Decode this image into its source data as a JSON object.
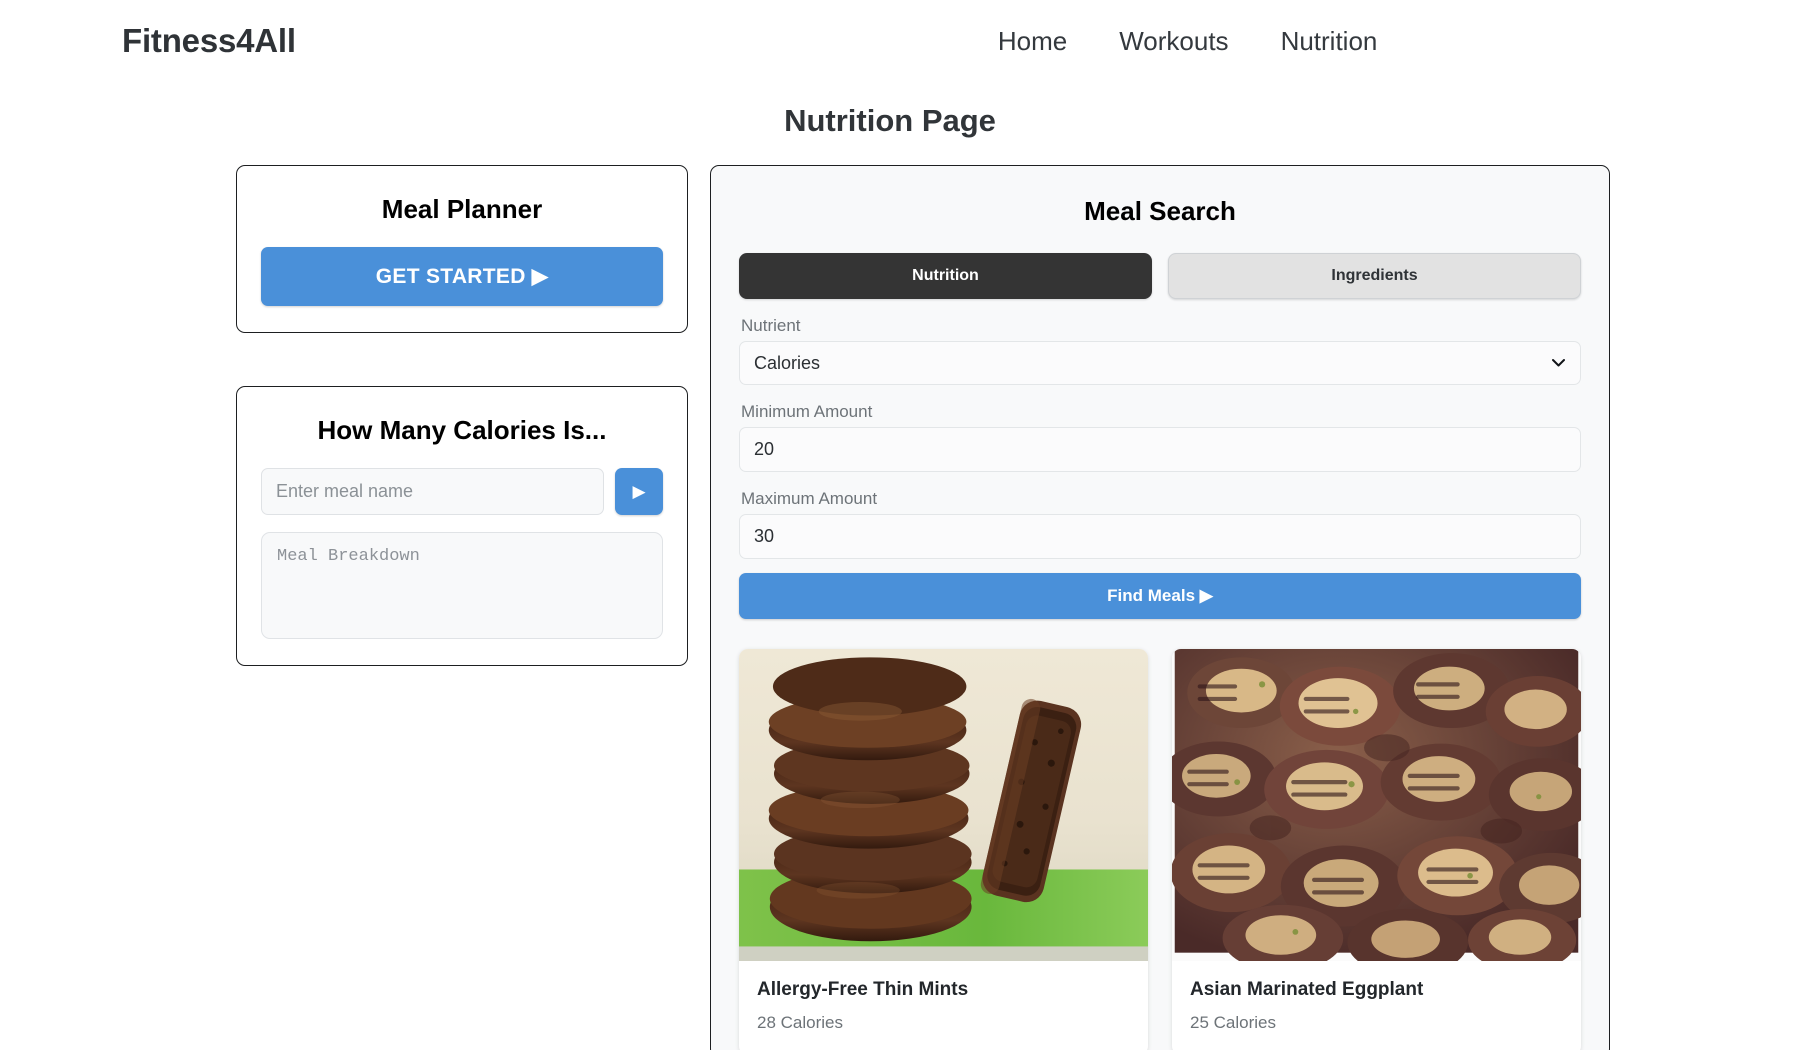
{
  "header": {
    "brand": "Fitness4All",
    "nav": [
      {
        "label": "Home"
      },
      {
        "label": "Workouts"
      },
      {
        "label": "Nutrition"
      }
    ]
  },
  "page": {
    "title": "Nutrition Page"
  },
  "meal_planner": {
    "title": "Meal Planner",
    "get_started_label": "GET STARTED ▶"
  },
  "calorie_lookup": {
    "title": "How Many Calories Is...",
    "input_value": "",
    "input_placeholder": "Enter meal name",
    "submit_icon": "▶",
    "breakdown_value": "",
    "breakdown_placeholder": "Meal Breakdown"
  },
  "meal_search": {
    "title": "Meal Search",
    "tabs": [
      {
        "label": "Nutrition",
        "active": true
      },
      {
        "label": "Ingredients",
        "active": false
      }
    ],
    "fields": {
      "nutrient_label": "Nutrient",
      "nutrient_value": "Calories",
      "nutrient_options": [
        "Calories"
      ],
      "min_label": "Minimum Amount",
      "min_value": "20",
      "max_label": "Maximum Amount",
      "max_value": "30"
    },
    "find_button_label": "Find Meals ▶",
    "results": [
      {
        "name": "Allergy-Free Thin Mints",
        "calories": "28 Calories",
        "image": "chocolate-cookie-stack-photo"
      },
      {
        "name": "Asian Marinated Eggplant",
        "calories": "25 Calories",
        "image": "grilled-eggplant-slices-photo"
      }
    ]
  },
  "colors": {
    "accent_blue": "#4a90d9",
    "tab_active": "#343434",
    "tab_inactive": "#e2e2e2",
    "panel_bg": "#f8f9fa",
    "text_dark": "#23272b",
    "text_muted": "#6d7378"
  }
}
